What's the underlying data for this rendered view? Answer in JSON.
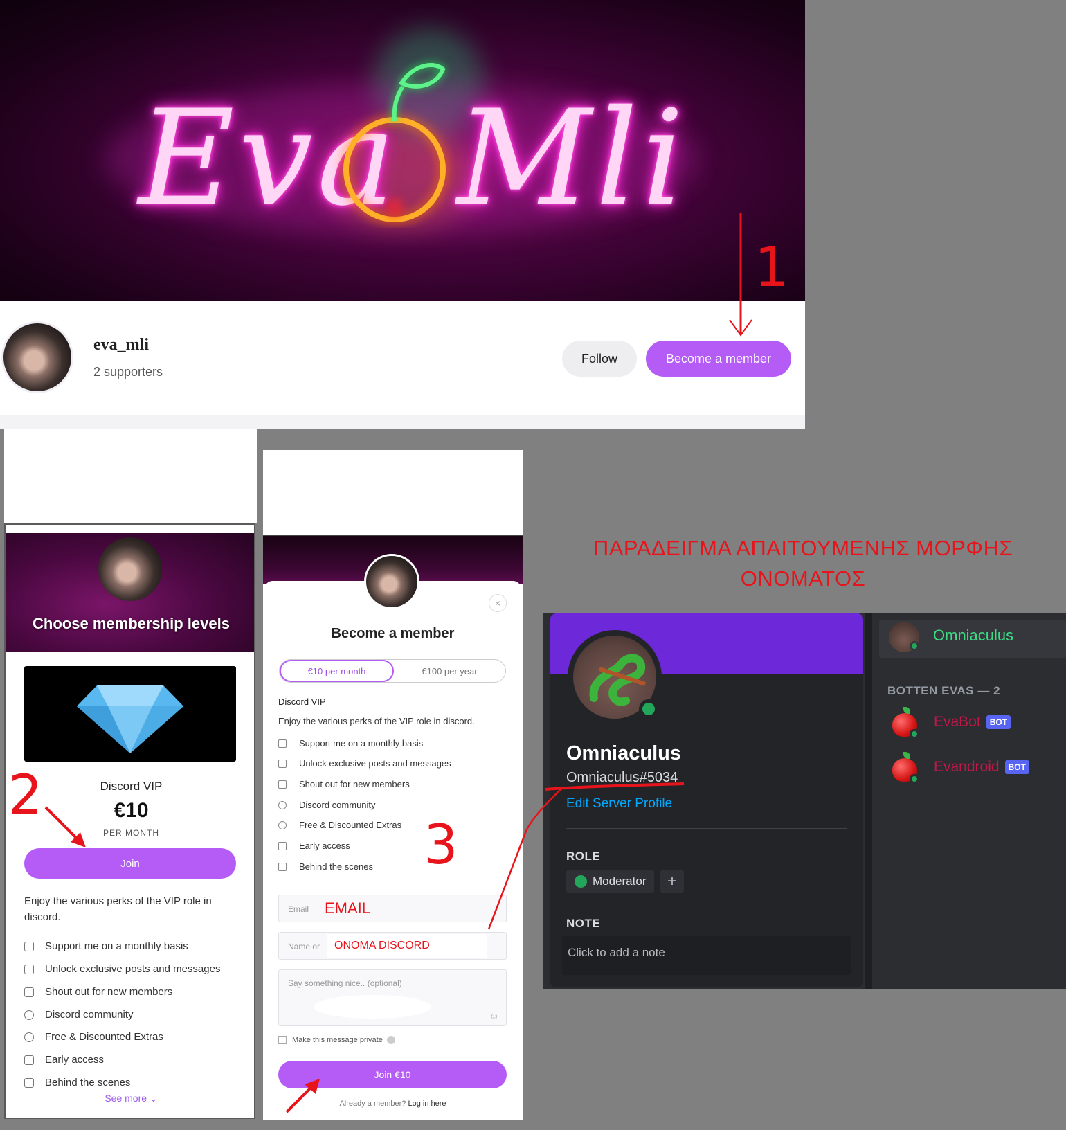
{
  "profile": {
    "banner_text_left": "Eva",
    "banner_text_right": "Mli",
    "username": "eva_mli",
    "supporters": "2 supporters",
    "follow_label": "Follow",
    "become_member_label": "Become a member"
  },
  "annotations": {
    "step1": "1",
    "step2": "2",
    "step3": "3",
    "email_hint": "EMAIL",
    "name_hint": "ONOMA DISCORD",
    "heading_line1": "ΠΑΡΑΔΕΙΓΜΑ ΑΠΑΙΤΟΥΜΕΝΗΣ ΜΟΡΦΗΣ",
    "heading_line2": "ΟΝΟΜΑΤΟΣ",
    "annotation_color": "#e8141c"
  },
  "membership_levels": {
    "title": "Choose membership levels",
    "tier_name": "Discord VIP",
    "price": "€10",
    "period": "PER MONTH",
    "join_label": "Join",
    "description": "Enjoy the various perks of the VIP role in discord.",
    "perks": [
      "Support me on a monthly basis",
      "Unlock exclusive posts and messages",
      "Shout out for new members",
      "Discord community",
      "Free & Discounted Extras",
      "Early access",
      "Behind the scenes"
    ],
    "see_more": "See more ⌄"
  },
  "become_member": {
    "title": "Become a member",
    "close_icon": "×",
    "tabs": [
      "€10 per month",
      "€100 per year"
    ],
    "tier_name": "Discord VIP",
    "description": "Enjoy the various perks of the VIP role in discord.",
    "perks": [
      "Support me on a monthly basis",
      "Unlock exclusive posts and messages",
      "Shout out for new members",
      "Discord community",
      "Free & Discounted Extras",
      "Early access",
      "Behind the scenes"
    ],
    "email_placeholder": "Email",
    "name_placeholder": "Name or",
    "message_placeholder": "Say something nice.. (optional)",
    "private_label": "Make this message private",
    "join_label": "Join €10",
    "already_member": "Already a member?",
    "login_label": "Log in here"
  },
  "discord": {
    "display_name": "Omniaculus",
    "tag": "Omniaculus#5034",
    "edit_profile": "Edit Server Profile",
    "role_heading": "ROLE",
    "role": "Moderator",
    "add_role": "+",
    "note_heading": "NOTE",
    "note_placeholder": "Click to add a note",
    "member_list_user": "Omniaculus",
    "group_heading": "BOTTEN EVAS — 2",
    "members": [
      {
        "name": "EvaBot",
        "badge": "BOT"
      },
      {
        "name": "Evandroid",
        "badge": "BOT"
      }
    ],
    "accent": "#6d28d9",
    "online_color": "#23a55a"
  }
}
